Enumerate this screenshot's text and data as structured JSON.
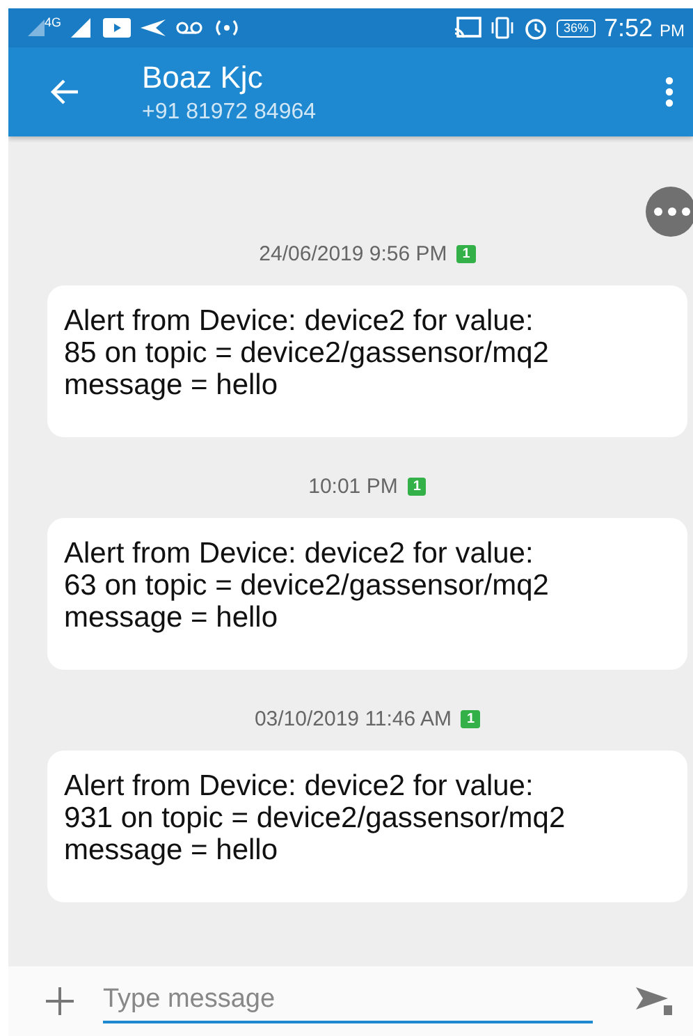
{
  "status_bar": {
    "network": "4G",
    "battery": "36%",
    "time": "7:52",
    "ampm": "PM"
  },
  "header": {
    "title": "Boaz Kjc",
    "subtitle": "+91 81972 84964"
  },
  "messages": [
    {
      "timestamp": "24/06/2019 9:56 PM",
      "sim": "1",
      "text": "Alert from Device: device2 for value: 85 on topic = device2/gassensor/mq2 message = hello"
    },
    {
      "timestamp": "10:01 PM",
      "sim": "1",
      "text": "Alert from Device: device2 for value: 63 on topic = device2/gassensor/mq2 message = hello"
    },
    {
      "timestamp": "03/10/2019 11:46 AM",
      "sim": "1",
      "text": "Alert from Device: device2 for value: 931 on topic = device2/gassensor/mq2 message = hello"
    }
  ],
  "composer": {
    "placeholder": "Type message"
  }
}
